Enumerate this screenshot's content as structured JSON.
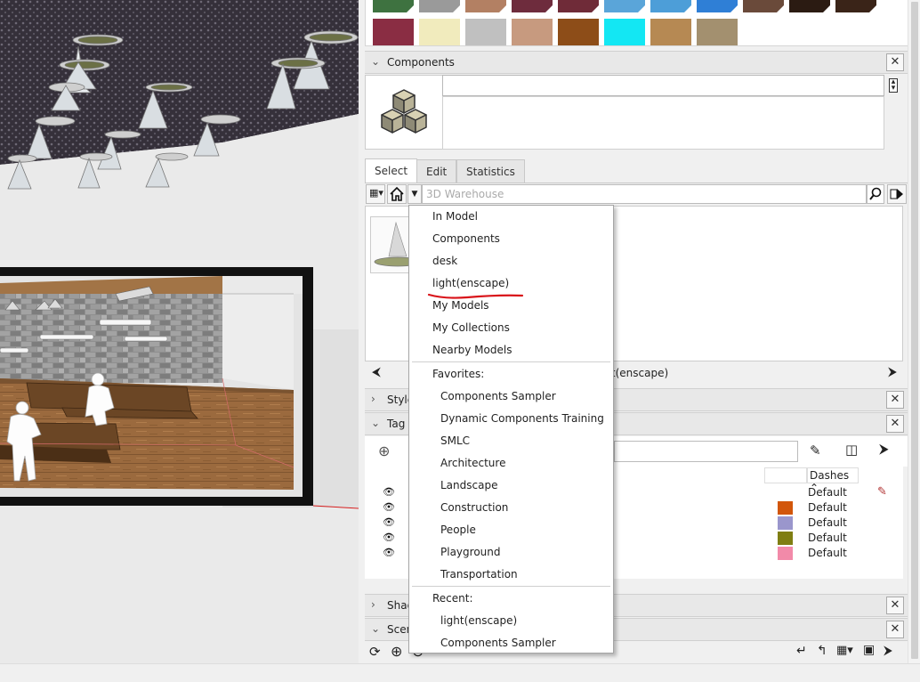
{
  "components_panel": {
    "title": "Components",
    "tabs": [
      "Select",
      "Edit",
      "Statistics"
    ],
    "search_placeholder": "3D Warehouse",
    "nav_breadcrumb": "light(enscape)"
  },
  "dropdown": {
    "items": [
      "In Model",
      "Components",
      "desk",
      "light(enscape)",
      "My Models",
      "My Collections",
      "Nearby Models"
    ],
    "favorites_label": "Favorites:",
    "favorites": [
      "Components Sampler",
      "Dynamic Components Training",
      "SMLC",
      "Architecture",
      "Landscape",
      "Construction",
      "People",
      "Playground",
      "Transportation"
    ],
    "recent_label": "Recent:",
    "recent": [
      "light(enscape)",
      "Components Sampler"
    ],
    "annotation_color": "#d9141a"
  },
  "panels": {
    "styles_label": "Style",
    "tags_label": "Tag",
    "shadows_label": "Shad",
    "scenes_label": "Scen"
  },
  "tags": {
    "dashes_header": "Dashes",
    "rows": [
      {
        "dashes": "Default",
        "color": "",
        "pencil": true
      },
      {
        "dashes": "Default",
        "color": "#d2560a"
      },
      {
        "dashes": "Default",
        "color": "#9a96cc"
      },
      {
        "dashes": "Default",
        "color": "#7f7e12"
      },
      {
        "dashes": "Default",
        "color": "#f28aa9"
      }
    ]
  },
  "swatches": {
    "row1": [
      "#3e7240",
      "#9a9a9a",
      "#b38063",
      "#6e2c3d",
      "#6f2b38",
      "#5aa5d9",
      "#4d9ed8",
      "#2f7fd6",
      "#6a4a3a",
      "#2b1b12",
      "#3a2418"
    ],
    "row2": [
      "#8a2d43",
      "#f1ebbd",
      "#c0c0c0",
      "#c79a7f",
      "#8d4d18",
      "#13e7f3",
      "#b68953",
      "#a3906f"
    ]
  }
}
